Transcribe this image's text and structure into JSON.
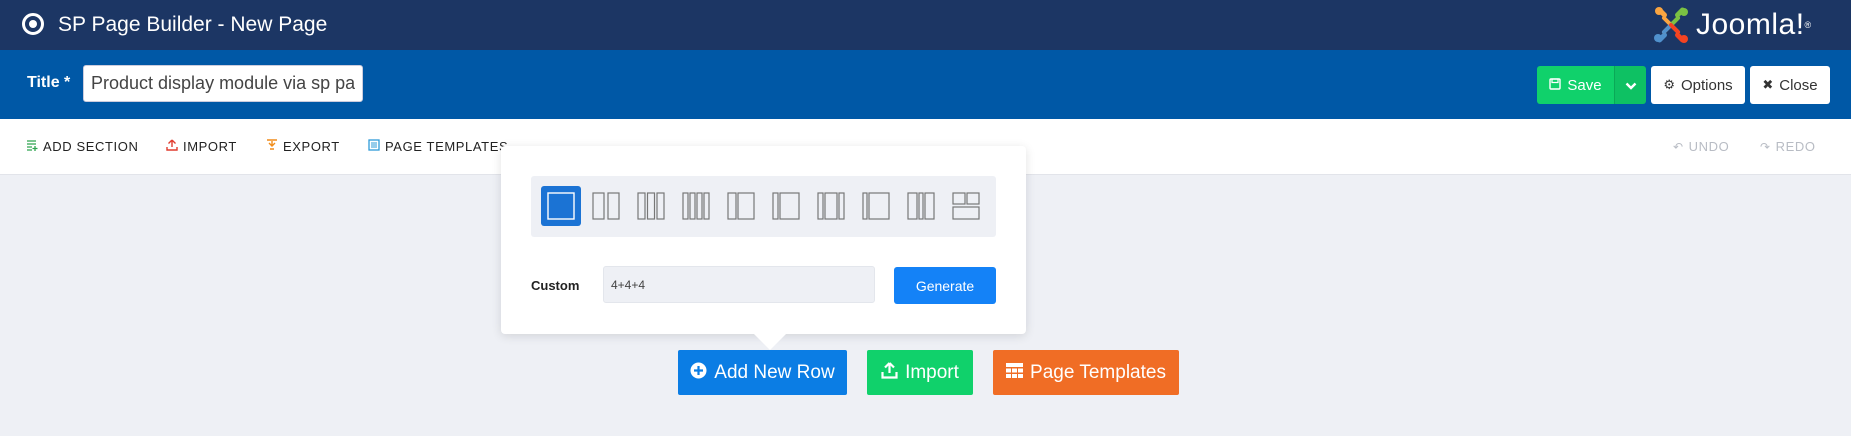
{
  "topbar": {
    "app_title": "SP Page Builder - New Page",
    "brand": "Joomla!",
    "brand_reg": "®",
    "logo_colors": [
      "#f9a541",
      "#f44321",
      "#5091cd",
      "#7ac143"
    ]
  },
  "titlebar": {
    "title_label": "Title *",
    "title_value": "Product display module via sp page builder",
    "save_label": "Save",
    "options_label": "Options",
    "close_label": "Close"
  },
  "toolbar": {
    "add_section": "ADD SECTION",
    "import": "IMPORT",
    "export": "EXPORT",
    "page_templates": "PAGE TEMPLATES",
    "undo": "UNDO",
    "redo": "REDO"
  },
  "popover": {
    "layouts": [
      "12",
      "6+6",
      "4+4+4",
      "3+3+3+3",
      "4+8",
      "3+9",
      "3+6+3",
      "2+10",
      "5+2+5",
      "custom-grid"
    ],
    "selected_layout": "12",
    "custom_label": "Custom",
    "custom_value": "4+4+4",
    "generate_label": "Generate"
  },
  "actions": {
    "add_new_row": "Add New Row",
    "import": "Import",
    "page_templates": "Page Templates"
  },
  "colors": {
    "topbar": "#1c3664",
    "titlebar": "#0058a6",
    "save": "#10d16b",
    "primary": "#0b7de4",
    "templates": "#f06d25"
  }
}
